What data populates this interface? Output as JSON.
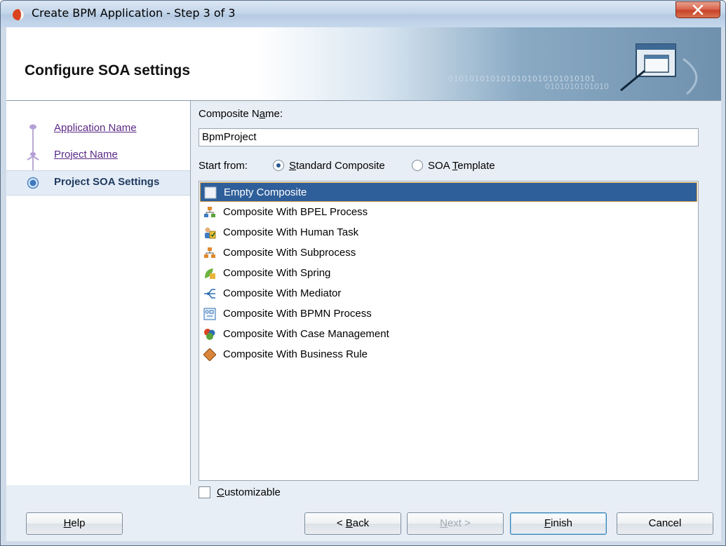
{
  "window": {
    "title": "Create BPM Application - Step 3 of 3"
  },
  "header": {
    "title": "Configure SOA settings",
    "binary_a": "0101010101010101010101010101",
    "binary_b": "0101010101010"
  },
  "nav": {
    "items": [
      {
        "label": "Application Name",
        "state": "visited"
      },
      {
        "label": "Project Name",
        "state": "visited"
      },
      {
        "label": "Project SOA Settings",
        "state": "current"
      }
    ]
  },
  "form": {
    "composite_name_label_pre": "Composite N",
    "composite_name_label_mn": "a",
    "composite_name_label_post": "me:",
    "composite_name_value": "BpmProject",
    "start_from_label": "Start from:",
    "radio_standard_mn": "S",
    "radio_standard_rest": "tandard Composite",
    "radio_standard_selected": true,
    "radio_template_pre": "SOA ",
    "radio_template_mn": "T",
    "radio_template_rest": "emplate",
    "radio_template_selected": false,
    "templates": [
      {
        "label": "Empty Composite",
        "icon": "empty-composite-icon",
        "selected": true
      },
      {
        "label": "Composite With BPEL Process",
        "icon": "bpel-process-icon",
        "selected": false
      },
      {
        "label": "Composite With Human Task",
        "icon": "human-task-icon",
        "selected": false
      },
      {
        "label": "Composite With Subprocess",
        "icon": "subprocess-icon",
        "selected": false
      },
      {
        "label": "Composite With Spring",
        "icon": "spring-icon",
        "selected": false
      },
      {
        "label": "Composite With Mediator",
        "icon": "mediator-icon",
        "selected": false
      },
      {
        "label": "Composite With BPMN Process",
        "icon": "bpmn-process-icon",
        "selected": false
      },
      {
        "label": "Composite With Case Management",
        "icon": "case-management-icon",
        "selected": false
      },
      {
        "label": "Composite With Business Rule",
        "icon": "business-rule-icon",
        "selected": false
      }
    ],
    "customizable_mn": "C",
    "customizable_rest": "ustomizable",
    "customizable_checked": false
  },
  "buttons": {
    "help_mn": "H",
    "help_rest": "elp",
    "back_pre": "< ",
    "back_mn": "B",
    "back_rest": "ack",
    "next_mn": "N",
    "next_rest": "ext >",
    "finish_mn": "F",
    "finish_rest": "inish",
    "cancel": "Cancel"
  },
  "colors": {
    "selection": "#2f5f9a",
    "link": "#5b2a86",
    "close": "#c8432a"
  }
}
